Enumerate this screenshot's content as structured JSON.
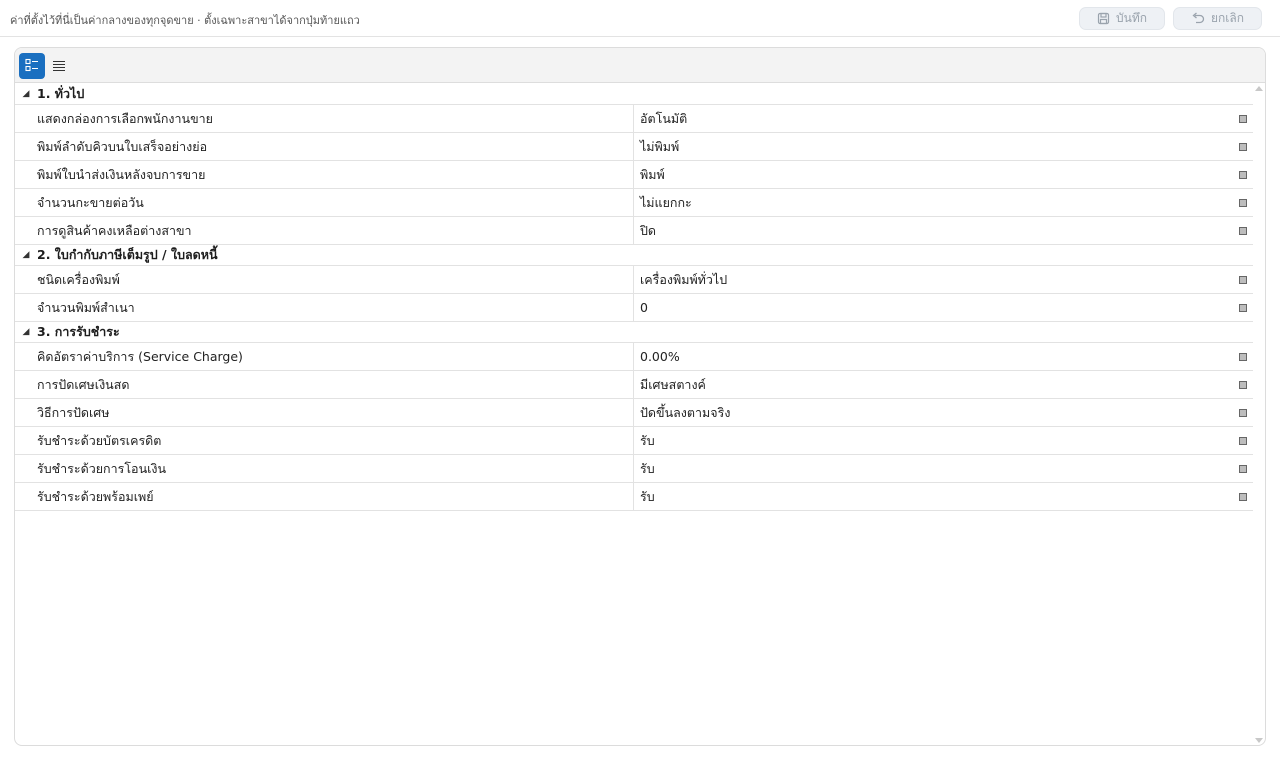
{
  "header": {
    "hint": "ค่าที่ตั้งไว้ที่นี่เป็นค่ากลางของทุกจุดขาย · ตั้งเฉพาะสาขาได้จากปุ่มท้ายแถว",
    "save_label": "บันทึก",
    "cancel_label": "ยกเลิก"
  },
  "toolbar": {
    "categorized_icon": "categorized-view-icon",
    "alphabetical_icon": "list-view-icon"
  },
  "sections": [
    {
      "title": "1. ทั่วไป",
      "rows": [
        {
          "name": "แสดงกล่องการเลือกพนักงานขาย",
          "value": "อัตโนมัติ"
        },
        {
          "name": "พิมพ์ลำดับคิวบนใบเสร็จอย่างย่อ",
          "value": "ไม่พิมพ์"
        },
        {
          "name": "พิมพ์ใบนำส่งเงินหลังจบการขาย",
          "value": "พิมพ์"
        },
        {
          "name": "จำนวนกะขายต่อวัน",
          "value": "ไม่แยกกะ"
        },
        {
          "name": "การดูสินค้าคงเหลือต่างสาขา",
          "value": "ปิด"
        }
      ]
    },
    {
      "title": "2. ใบกำกับภาษีเต็มรูป / ใบลดหนี้",
      "rows": [
        {
          "name": "ชนิดเครื่องพิมพ์",
          "value": "เครื่องพิมพ์ทั่วไป"
        },
        {
          "name": "จำนวนพิมพ์สำเนา",
          "value": "0"
        }
      ]
    },
    {
      "title": "3. การรับชำระ",
      "rows": [
        {
          "name": "คิดอัตราค่าบริการ (Service Charge)",
          "value": "0.00%"
        },
        {
          "name": "การปัดเศษเงินสด",
          "value": "มีเศษสตางค์"
        },
        {
          "name": "วิธีการปัดเศษ",
          "value": "ปัดขึ้นลงตามจริง"
        },
        {
          "name": "รับชำระด้วยบัตรเครดิต",
          "value": "รับ"
        },
        {
          "name": "รับชำระด้วยการโอนเงิน",
          "value": "รับ"
        },
        {
          "name": "รับชำระด้วยพร้อมเพย์",
          "value": "รับ"
        }
      ]
    }
  ],
  "colors": {
    "accent": "#1a6fc0",
    "grid_line": "#e2e2e2",
    "button_bg": "#eef1f5"
  }
}
